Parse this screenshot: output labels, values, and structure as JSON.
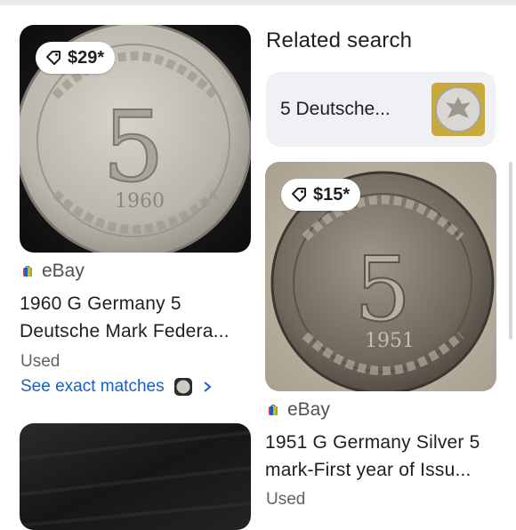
{
  "results": [
    {
      "price": "$29*",
      "source": "eBay",
      "title_line1": "1960 G Germany 5",
      "title_line2": "Deutsche Mark Federa...",
      "condition": "Used",
      "exact_matches_label": "See exact matches",
      "coin_year": "1960"
    },
    {
      "price": "$15*",
      "source": "eBay",
      "title_line1": "1951 G Germany Silver 5",
      "title_line2": "mark-First year of Issu...",
      "condition": "Used",
      "coin_year": "1951"
    }
  ],
  "related": {
    "heading": "Related search",
    "chip_label": "5 Deutsche..."
  },
  "icons": {
    "price_tag": "tag-icon",
    "ebay": "ebay-logo-icon",
    "chevron": "chevron-right-icon"
  },
  "colors": {
    "link": "#1a5fbf",
    "chip_bg": "#f0f1f4",
    "page_bg": "#ffffff"
  }
}
